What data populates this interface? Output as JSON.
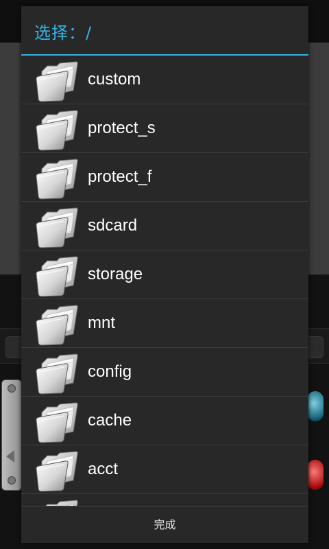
{
  "dialog": {
    "title": "选择：/",
    "accent_color": "#33b5e5",
    "folder_icon": "folder-icon",
    "folders": [
      {
        "label": "custom"
      },
      {
        "label": "protect_s"
      },
      {
        "label": "protect_f"
      },
      {
        "label": "sdcard"
      },
      {
        "label": "storage"
      },
      {
        "label": "mnt"
      },
      {
        "label": "config"
      },
      {
        "label": "cache"
      },
      {
        "label": "acct"
      },
      {
        "label": ""
      }
    ],
    "done_label": "完成"
  }
}
